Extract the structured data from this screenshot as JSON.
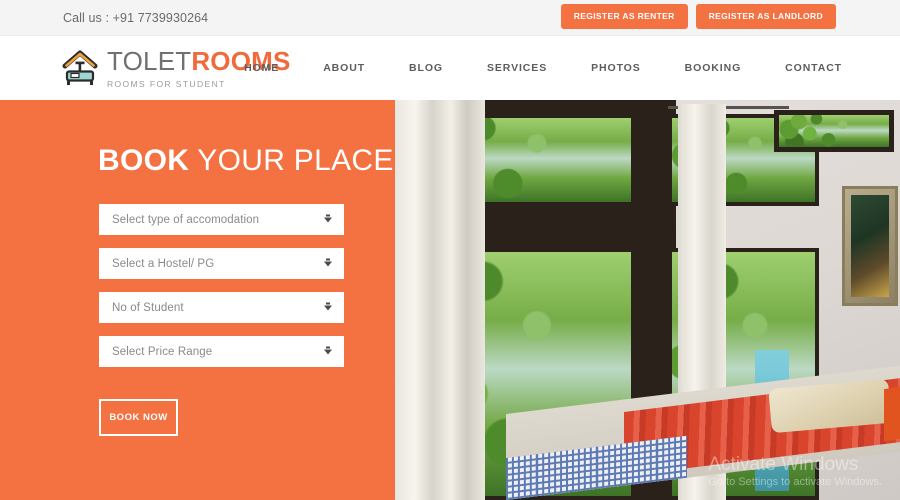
{
  "topbar": {
    "phone_label": "Call us : +91 7739930264",
    "buttons": [
      {
        "label": "REGISTER AS RENTER",
        "name": "register-as-renter-button"
      },
      {
        "label": "REGISTER AS LANDLORD",
        "name": "register-as-landlord-button"
      }
    ],
    "bg_color": "#f4f4f4"
  },
  "header": {
    "logo_icon": "house-bed-icon",
    "brand_word_1": "TOLET",
    "brand_word_2": "ROOMS",
    "brand_tagline": "ROOMS FOR STUDENT",
    "nav": [
      {
        "label": "HOME"
      },
      {
        "label": "ABOUT"
      },
      {
        "label": "BLOG"
      },
      {
        "label": "SERVICES"
      },
      {
        "label": "PHOTOS"
      },
      {
        "label": "BOOKING"
      },
      {
        "label": "CONTACT"
      }
    ]
  },
  "hero": {
    "title_bold": "BOOK",
    "title_light": " YOUR PLACE",
    "accent_color": "#f47142",
    "form": {
      "fields": [
        {
          "placeholder": "Select type of accomodation",
          "value": "",
          "name": "accommodation-type-select"
        },
        {
          "placeholder": "Select a Hostel/ PG",
          "value": "",
          "name": "hostel-pg-select"
        },
        {
          "placeholder": "No of Student",
          "value": "",
          "name": "number-of-students-select"
        },
        {
          "placeholder": "Select Price Range",
          "value": "",
          "name": "price-range-select"
        }
      ],
      "submit_label": "BOOK NOW"
    },
    "image_alt": "bedroom-with-garden-view-photo",
    "watermark_line_1": "Activate Windows",
    "watermark_line_2": "Go to Settings to activate Windows."
  }
}
